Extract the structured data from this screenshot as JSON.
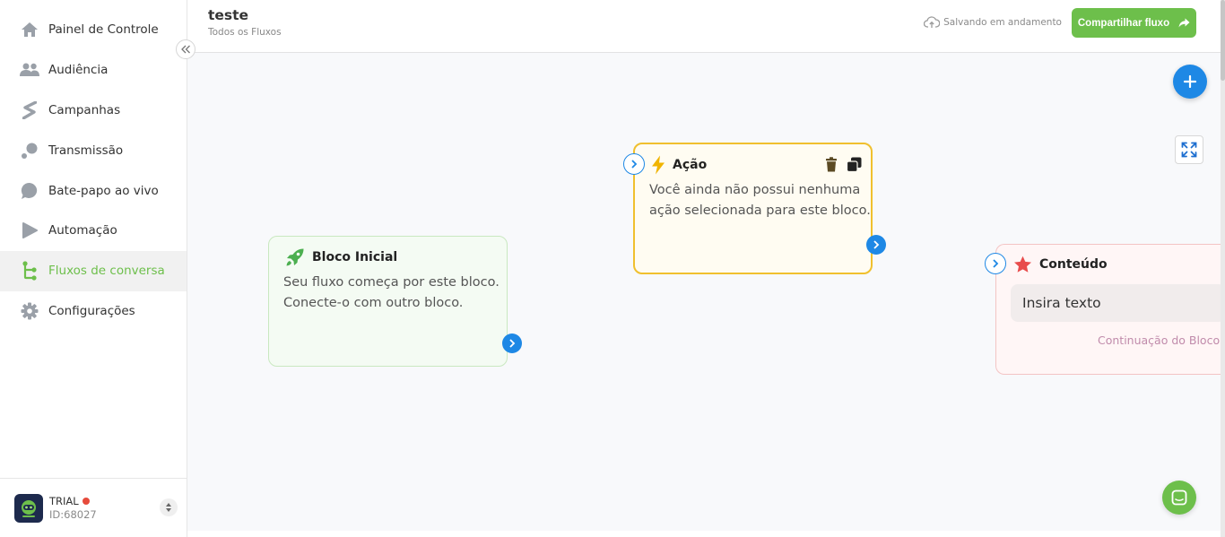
{
  "sidebar": {
    "items": [
      {
        "label": "Painel de Controle",
        "icon": "home-icon"
      },
      {
        "label": "Audiência",
        "icon": "users-icon"
      },
      {
        "label": "Campanhas",
        "icon": "campaign-icon"
      },
      {
        "label": "Transmissão",
        "icon": "broadcast-icon"
      },
      {
        "label": "Bate-papo ao vivo",
        "icon": "chat-bubble-icon"
      },
      {
        "label": "Automação",
        "icon": "automation-icon"
      },
      {
        "label": "Fluxos de conversa",
        "icon": "flow-icon"
      },
      {
        "label": "Configurações",
        "icon": "gear-icon"
      }
    ],
    "active_index": 6,
    "account": {
      "plan": "TRIAL",
      "id": "ID:68027"
    }
  },
  "header": {
    "title": "teste",
    "breadcrumb": "Todos os Fluxos",
    "saving_status": "Salvando em andamento",
    "share_label": "Compartilhar fluxo"
  },
  "blocks": {
    "start": {
      "title": "Bloco Inicial",
      "line1": "Seu fluxo começa por este bloco.",
      "line2": "Conecte-o com outro bloco."
    },
    "action": {
      "title": "Ação",
      "line1": "Você ainda não possui nenhuma",
      "line2": "ação selecionada para este bloco."
    },
    "content": {
      "title": "Conteúdo",
      "input_text": "Insira texto",
      "continuation": "Continuação do Bloco"
    }
  },
  "colors": {
    "brand_green": "#6dbf4b",
    "accent_blue": "#1e88e5",
    "action_border": "#f0c02e",
    "content_star": "#e84c4c"
  }
}
